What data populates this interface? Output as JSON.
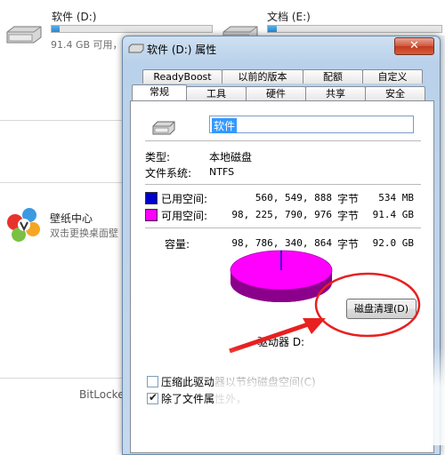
{
  "background": {
    "drive_d": {
      "name": "软件 (D:)",
      "size": "91.4 GB 可用，",
      "used_fraction": 0.05
    },
    "drive_e": {
      "name": "文档 (E:)",
      "used_fraction": 0.05
    },
    "wallpaper": {
      "title": "壁纸中心",
      "subtitle": "双击更换桌面壁"
    },
    "bitlocker": "BitLocke"
  },
  "dialog": {
    "title": "软件 (D:) 属性",
    "close": "✕",
    "tabs_row1": [
      "ReadyBoost",
      "以前的版本",
      "配额",
      "自定义"
    ],
    "tabs_row2": [
      "常规",
      "工具",
      "硬件",
      "共享",
      "安全"
    ],
    "active_tab": "常规",
    "name_value": "软件",
    "type_label": "类型:",
    "type_value": "本地磁盘",
    "fs_label": "文件系统:",
    "fs_value": "NTFS",
    "used": {
      "label": "已用空间:",
      "bytes": "560, 549, 888",
      "unit": "字节",
      "human": "534 MB",
      "color": "#0000cc"
    },
    "free": {
      "label": "可用空间:",
      "bytes": "98, 225, 790, 976",
      "unit": "字节",
      "human": "91.4 GB",
      "color": "#ff00ff"
    },
    "capacity": {
      "label": "容量:",
      "bytes": "98, 786, 340, 864",
      "unit": "字节",
      "human": "92.0 GB"
    },
    "drive_label": "驱动器 D:",
    "cleanup_button": "磁盘清理(D)",
    "compress_label": "压缩此驱动器以节约磁盘空间(C)",
    "index_label": "除了文件属性外，"
  }
}
